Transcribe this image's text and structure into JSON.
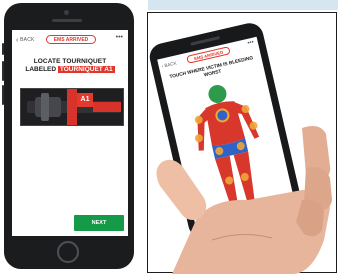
{
  "left_screen": {
    "back_label": "BACK",
    "status_pill": "EMS ARRIVED",
    "menu_glyph": "•••",
    "instruction_line1": "LOCATE TOURNIQUET",
    "instruction_line2_prefix": "LABELED",
    "instruction_line2_highlight": "TOURNIQUET A1",
    "tourniquet_tag": "A1",
    "next_button": "NEXT"
  },
  "right_screen": {
    "back_label": "BACK",
    "status_pill": "EMS ARRIVED",
    "menu_glyph": "•••",
    "instruction": "TOUCH WHERE VICTIM IS BLEEDING WORST"
  },
  "colors": {
    "accent_red": "#e3362b",
    "next_green": "#159a48",
    "body_head_green": "#2e9a4b",
    "target_orange": "#f0a53a",
    "target_blue": "#2f63c8",
    "phone_body": "#1b1c1e"
  },
  "icons": {
    "back": "chevron-left-icon",
    "menu": "more-dots-icon",
    "home_button": "home-button-icon",
    "body_map": "human-body-map-icon"
  }
}
